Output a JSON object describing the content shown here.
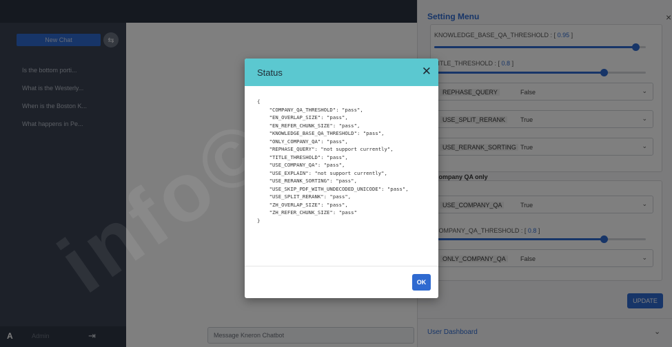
{
  "sidebar": {
    "new_chat_label": "New Chat",
    "history": [
      "Is the bottom porti...",
      "What is the Westerly...",
      "When is the Boston K...",
      "What happens in Pe..."
    ],
    "user_name": "Admin"
  },
  "main": {
    "input_placeholder": "Message Kneron Chatbot"
  },
  "settings": {
    "title": "Setting Menu",
    "sliders": [
      {
        "label": "KNOWLEDGE_BASE_QA_THRESHOLD : ",
        "value": "0.95",
        "fraction": 0.95
      },
      {
        "label": "TITLE_THRESHOLD : ",
        "value": "0.8",
        "fraction": 0.8
      }
    ],
    "selects": [
      {
        "label": "REPHASE_QUERY",
        "value": "False"
      },
      {
        "label": "USE_SPLIT_RERANK",
        "value": "True"
      },
      {
        "label": "USE_RERANK_SORTING",
        "value": "True"
      }
    ],
    "group_title": "Company QA only",
    "company_select": {
      "label": "USE_COMPANY_QA",
      "value": "True"
    },
    "company_slider": {
      "label": "COMPANY_QA_THRESHOLD : ",
      "value": "0.8",
      "fraction": 0.8
    },
    "only_company_select": {
      "label": "ONLY_COMPANY_QA",
      "value": "False"
    },
    "update_label": "UPDATE",
    "dashboard_label": "User Dashboard"
  },
  "modal": {
    "title": "Status",
    "ok_label": "OK",
    "json_lines": [
      "{",
      "    \"COMPANY_QA_THRESHOLD\": \"pass\",",
      "    \"EN_OVERLAP_SIZE\": \"pass\",",
      "    \"EN_REFER_CHUNK_SIZE\": \"pass\",",
      "    \"KNOWLEDGE_BASE_QA_THRESHOLD\": \"pass\",",
      "    \"ONLY_COMPANY_QA\": \"pass\",",
      "    \"REPHASE_QUERY\": \"not support currently\",",
      "    \"TITLE_THRESHOLD\": \"pass\",",
      "    \"USE_COMPANY_QA\": \"pass\",",
      "    \"USE_EXPLAIN\": \"not support currently\",",
      "    \"USE_RERANK_SORTING\": \"pass\",",
      "    \"USE_SKIP_PDF_WITH_UNDECODED_UNICODE\": \"pass\",",
      "    \"USE_SPLIT_RERANK\": \"pass\",",
      "    \"ZH_OVERLAP_SIZE\": \"pass\",",
      "    \"ZH_REFER_CHUNK_SIZE\": \"pass\"",
      "}"
    ]
  },
  "colors": {
    "accent": "#2f6ad0",
    "modal_header": "#5bc8d0",
    "sidebar": "#3a4252"
  }
}
